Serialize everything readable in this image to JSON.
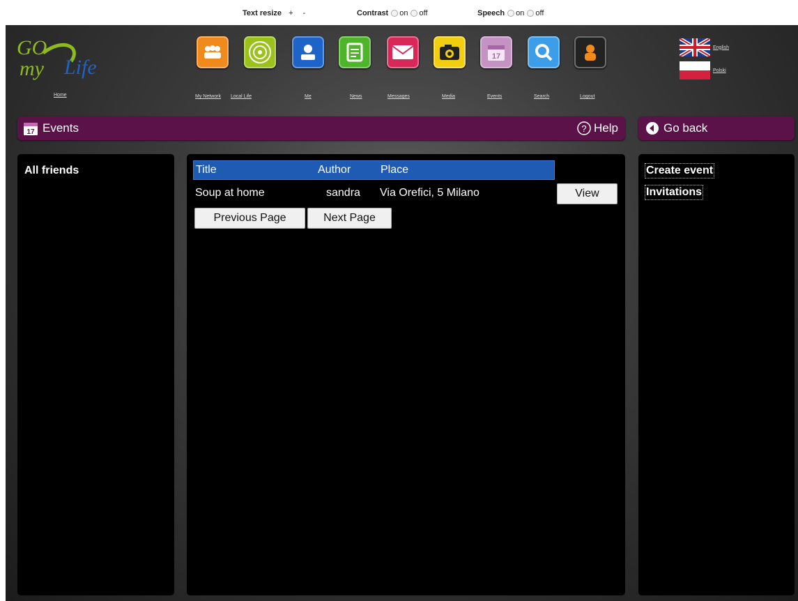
{
  "accessibility": {
    "text_resize_label": "Text resize",
    "text_increase": "+",
    "text_decrease": "-",
    "contrast_label": "Contrast",
    "speech_label": "Speech",
    "on_label": "on",
    "off_label": "off"
  },
  "header": {
    "home_label": "Home",
    "nav": [
      {
        "label": "My Network",
        "icon": "network-icon",
        "color": "#f08a1c"
      },
      {
        "label": "Local Life",
        "icon": "local-life-icon",
        "color": "#9bc21a"
      },
      {
        "label": "Me",
        "icon": "profile-icon",
        "color": "#1e63c8"
      },
      {
        "label": "News",
        "icon": "news-icon",
        "color": "#4eb42a"
      },
      {
        "label": "Messages",
        "icon": "mail-icon",
        "color": "#d8285a"
      },
      {
        "label": "Media",
        "icon": "camera-icon",
        "color": "#f1cf10"
      },
      {
        "label": "Events",
        "icon": "calendar-icon",
        "color": "#c493c4"
      },
      {
        "label": "Search",
        "icon": "search-icon",
        "color": "#3c9ee8"
      },
      {
        "label": "Logout",
        "icon": "logout-icon",
        "color": "#222222"
      }
    ],
    "languages": [
      {
        "label": "English",
        "icon": "uk-flag-icon"
      },
      {
        "label": "Polski",
        "icon": "poland-flag-icon"
      }
    ]
  },
  "section_bar": {
    "title": "Events",
    "calendar_day": "17",
    "help_label": "Help",
    "go_back_label": "Go back"
  },
  "left_panel": {
    "title": "All friends"
  },
  "events_table": {
    "headers": [
      "Title",
      "Author",
      "Place"
    ],
    "rows": [
      {
        "title": "Soup at home",
        "author": "sandra",
        "place": "Via Orefici, 5 Milano",
        "action": "View"
      }
    ],
    "prev_label": "Previous Page",
    "next_label": "Next Page"
  },
  "right_panel": {
    "links": [
      "Create event",
      "Invitations"
    ]
  },
  "colors": {
    "accent_purple": "#5a1248",
    "header_blue": "#1f5bb3"
  }
}
